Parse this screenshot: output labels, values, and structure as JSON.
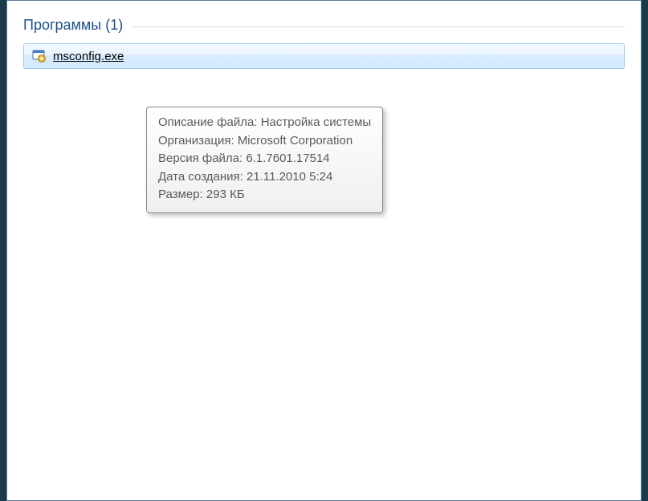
{
  "section": {
    "title": "Программы (1)"
  },
  "result": {
    "filename": "msconfig.exe"
  },
  "tooltip": {
    "rows": [
      {
        "label": "Описание файла:",
        "value": "Настройка системы"
      },
      {
        "label": "Организация:",
        "value": "Microsoft Corporation"
      },
      {
        "label": "Версия файла:",
        "value": "6.1.7601.17514"
      },
      {
        "label": "Дата создания:",
        "value": "21.11.2010 5:24"
      },
      {
        "label": "Размер:",
        "value": "293 КБ"
      }
    ]
  }
}
